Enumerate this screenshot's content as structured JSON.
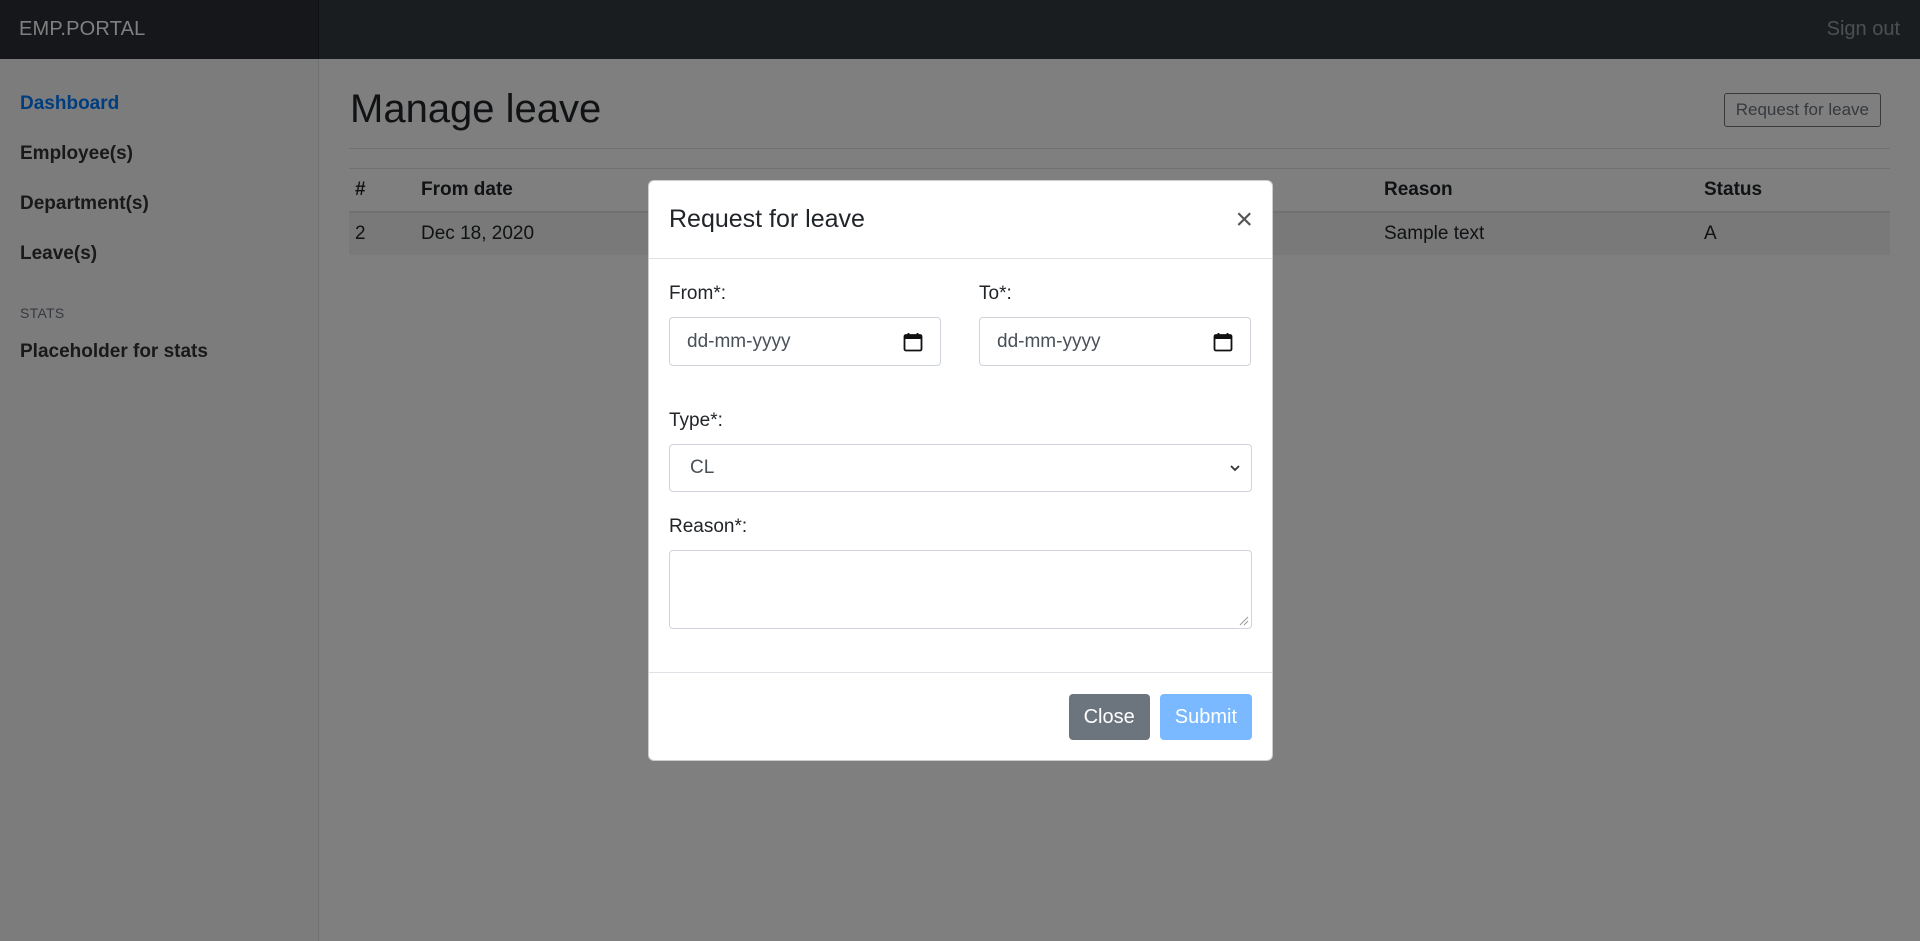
{
  "navbar": {
    "brand": "EMP.PORTAL",
    "signout": "Sign out"
  },
  "sidebar": {
    "items": [
      {
        "label": "Dashboard",
        "active": true
      },
      {
        "label": "Employee(s)"
      },
      {
        "label": "Department(s)"
      },
      {
        "label": "Leave(s)"
      }
    ],
    "stats_heading": "STATS",
    "stats_item": "Placeholder for stats"
  },
  "main": {
    "title": "Manage leave",
    "request_button": "Request for leave",
    "table": {
      "headers": [
        "#",
        "From date",
        "Reason",
        "Status"
      ],
      "rows": [
        {
          "num": "2",
          "from": "Dec 18, 2020",
          "reason": "Sample text",
          "status": "A"
        }
      ]
    }
  },
  "modal": {
    "title": "Request for leave",
    "close_symbol": "×",
    "from_label": "From*:",
    "from_placeholder": "dd-mm-yyyy",
    "to_label": "To*:",
    "to_placeholder": "dd-mm-yyyy",
    "type_label": "Type*:",
    "type_value": "CL",
    "reason_label": "Reason*:",
    "reason_value": "",
    "close_button": "Close",
    "submit_button": "Submit"
  },
  "colors": {
    "navbar": "#343a40",
    "accent": "#007bff",
    "submit_disabled": "#7ab9ff",
    "secondary": "#6c757d"
  },
  "icons": [
    "calendar-icon",
    "chevron-down-icon",
    "close-icon"
  ]
}
